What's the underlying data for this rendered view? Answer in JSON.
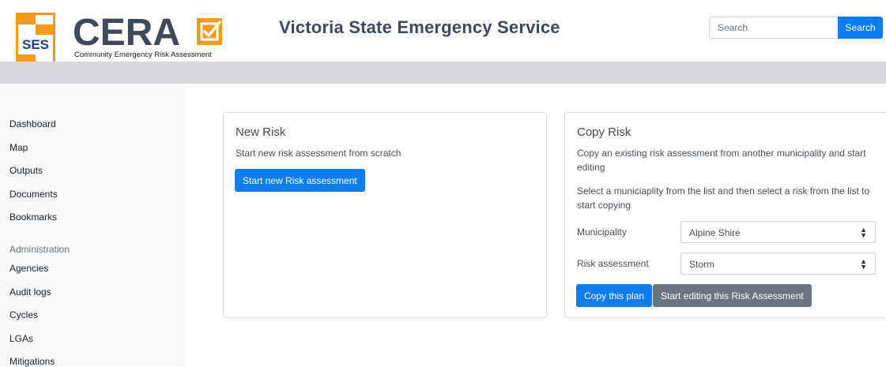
{
  "header": {
    "ses_logo_text": "SES",
    "cera_logo_text": "CERA",
    "cera_tagline": "Community Emergency Risk Assessment",
    "title": "Victoria State Emergency Service",
    "search_placeholder": "Search",
    "search_button": "Search"
  },
  "sidebar": {
    "items": [
      "Dashboard",
      "Map",
      "Outputs",
      "Documents",
      "Bookmarks"
    ],
    "admin_heading": "Administration",
    "admin_items": [
      "Agencies",
      "Audit logs",
      "Cycles",
      "LGAs",
      "Mitigations"
    ]
  },
  "new_risk": {
    "title": "New Risk",
    "description": "Start new risk assessment from scratch",
    "button": "Start new Risk assessment"
  },
  "copy_risk": {
    "title": "Copy Risk",
    "description_line1": "Copy an existing risk assessment from another municipality and start",
    "description_line2": "editing",
    "instruction_line1": "Select a municiaplity from the list and then select a risk from the list to",
    "instruction_line2": "start copying",
    "municipality_label": "Municipality",
    "municipality_value": "Alpine Shire",
    "risk_label": "Risk assessment",
    "risk_value": "Storm",
    "copy_button": "Copy this plan",
    "edit_button": "Start editing this Risk Assessment"
  },
  "colors": {
    "primary": "#0d7ef2",
    "secondary": "#6c757d",
    "logo_orange": "#f39a1f",
    "logo_navy": "#3d4a5c",
    "ses_blue": "#1f3e8a"
  },
  "icons": {
    "select_chevron": "chevron-updown-icon",
    "cera_check": "checkbox-tick-icon"
  }
}
